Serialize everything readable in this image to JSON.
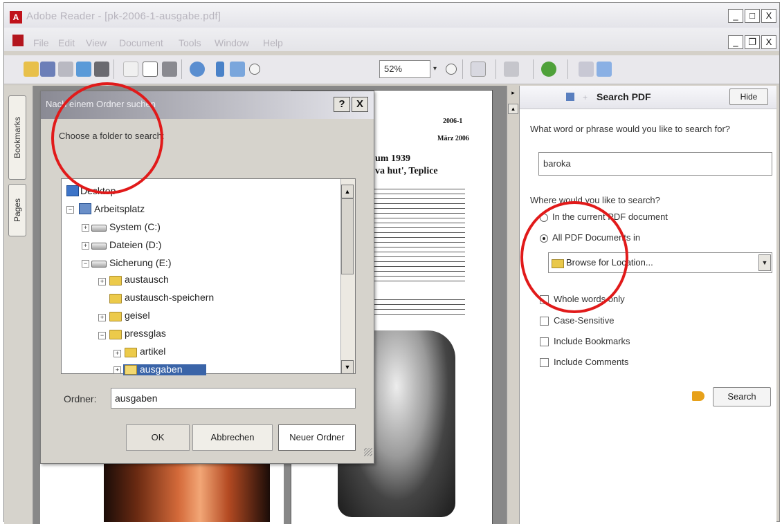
{
  "window": {
    "title": "Adobe Reader - [pk-2006-1-ausgabe.pdf]",
    "controls": {
      "minimize": "_",
      "maximize": "□",
      "close": "X",
      "doc_minimize": "_",
      "doc_restore": "❐",
      "doc_close": "X"
    }
  },
  "menu": {
    "items": [
      "File",
      "Edit",
      "View",
      "Document",
      "Tools",
      "Window",
      "Help"
    ]
  },
  "toolbar": {
    "zoom_value": "52%"
  },
  "nav": {
    "tabs": [
      "Bookmarks",
      "Pages"
    ]
  },
  "document": {
    "header_number": "2006-1",
    "header_date": "März 2006",
    "heading_line1": "um 1939",
    "heading_line2": "va hut', Teplice"
  },
  "search_panel": {
    "title": "Search PDF",
    "hide_label": "Hide",
    "question": "What word or phrase would you like to search for?",
    "search_value": "baroka",
    "where_label": "Where would you like to search?",
    "scope_options": [
      {
        "label": "In the current PDF document",
        "selected": false
      },
      {
        "label": "All PDF Documents in",
        "selected": true
      }
    ],
    "location_value": "Browse for Location...",
    "checkboxes": [
      {
        "label": "Whole words only",
        "checked": false
      },
      {
        "label": "Case-Sensitive",
        "checked": false
      },
      {
        "label": "Include Bookmarks",
        "checked": false
      },
      {
        "label": "Include Comments",
        "checked": false
      }
    ],
    "search_button": "Search"
  },
  "dialog": {
    "title": "Nach einem Ordner suchen",
    "help": "?",
    "close": "X",
    "prompt": "Choose a folder to search:",
    "tree": [
      {
        "label": "Desktop",
        "icon": "desktop-icon",
        "expander": ""
      },
      {
        "label": "Arbeitsplatz",
        "icon": "computer-icon",
        "expander": "−"
      },
      {
        "label": "System (C:)",
        "icon": "drive-icon",
        "expander": "+"
      },
      {
        "label": "Dateien (D:)",
        "icon": "drive-icon",
        "expander": "+"
      },
      {
        "label": "Sicherung (E:)",
        "icon": "drive-icon",
        "expander": "−"
      },
      {
        "label": "austausch",
        "icon": "folder-icon",
        "expander": "+"
      },
      {
        "label": "austausch-speichern",
        "icon": "folder-icon",
        "expander": ""
      },
      {
        "label": "geisel",
        "icon": "folder-icon",
        "expander": "+"
      },
      {
        "label": "pressglas",
        "icon": "folder-icon",
        "expander": "−"
      },
      {
        "label": "artikel",
        "icon": "folder-icon",
        "expander": "+"
      },
      {
        "label": "ausgaben",
        "icon": "folder-open-icon",
        "expander": "+"
      }
    ],
    "folder_label": "Ordner:",
    "folder_value": "ausgaben",
    "ok_label": "OK",
    "cancel_label": "Abbrechen",
    "new_folder_label": "Neuer Ordner"
  },
  "colors": {
    "annotation": "#e11a1a",
    "selection": "#3a64a8"
  }
}
